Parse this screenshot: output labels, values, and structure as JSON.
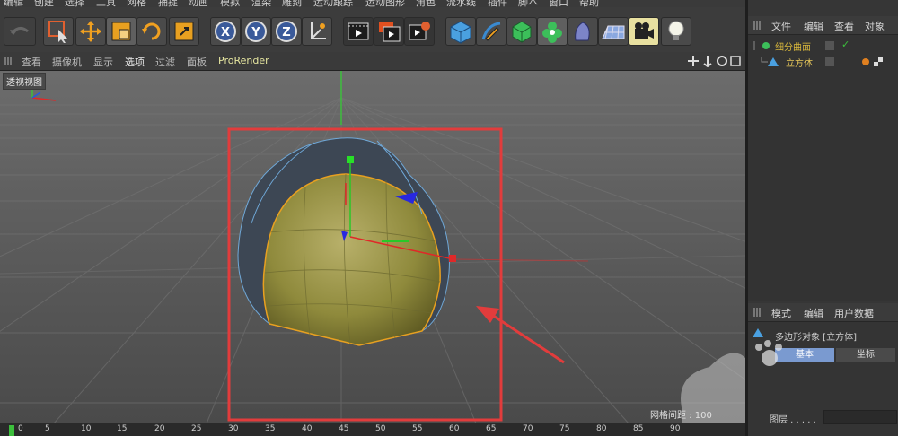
{
  "menu": {
    "items": [
      "编辑",
      "创建",
      "选择",
      "工具",
      "网格",
      "捕捉",
      "动画",
      "模拟",
      "渲染",
      "雕刻",
      "运动跟踪",
      "运动图形",
      "角色",
      "流水线",
      "插件",
      "脚本",
      "窗口",
      "帮助"
    ]
  },
  "viewport_menu": {
    "items": [
      "查看",
      "摄像机",
      "显示",
      "选项",
      "过滤",
      "面板"
    ],
    "active": "选项",
    "prorender": "ProRender"
  },
  "viewport": {
    "label": "透视视图",
    "grid_spacing_label": "网格间距 : 100",
    "highlight_color": "#e23c3c",
    "object_color": "#8f8a3c"
  },
  "timeline": {
    "ticks": [
      "0",
      "5",
      "10",
      "15",
      "20",
      "25",
      "30",
      "35",
      "40",
      "45",
      "50",
      "55",
      "60",
      "65",
      "70",
      "75",
      "80",
      "85",
      "90"
    ]
  },
  "object_manager": {
    "tabs": [
      "文件",
      "编辑",
      "查看",
      "对象"
    ],
    "objects": [
      {
        "name": "细分曲面",
        "color": "#d9b83c"
      },
      {
        "name": "立方体",
        "color": "#e8c85a"
      }
    ]
  },
  "attribute_manager": {
    "tabs": [
      "模式",
      "编辑",
      "用户数据"
    ],
    "object_title": "多边形对象 [立方体]",
    "subtabs": [
      "基本",
      "坐标"
    ],
    "active_subtab": "基本",
    "layer_label": "图层 . . . . ."
  },
  "icons": [
    "undo-icon",
    "live-selection-icon",
    "move-icon",
    "scale-icon",
    "rotate-icon",
    "tool-icon",
    "x-axis-icon",
    "y-axis-icon",
    "z-axis-icon",
    "coordinate-system-icon",
    "render-view-icon",
    "render-picture-viewer-icon",
    "render-settings-icon",
    "cube-icon",
    "pen-icon",
    "subdivision-icon",
    "cloner-icon",
    "deformer-icon",
    "floor-icon",
    "camera-icon",
    "light-icon"
  ]
}
